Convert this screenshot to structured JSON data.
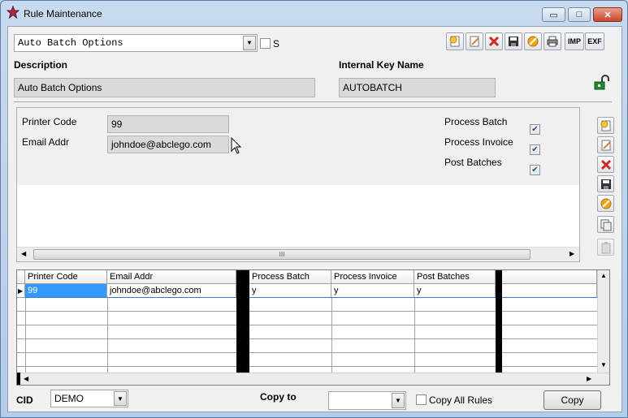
{
  "window": {
    "title": "Rule Maintenance",
    "controls": {
      "minimize": "▭",
      "maximize": "□",
      "close": "✕"
    }
  },
  "header": {
    "rule_select": "Auto Batch Options",
    "s_checkbox_label": "S",
    "s_checked": false
  },
  "toolbar": {
    "buttons": [
      "new",
      "edit",
      "delete",
      "save",
      "cancel",
      "print"
    ],
    "imp_label": "IMP",
    "exp_label": "EXF"
  },
  "description": {
    "label": "Description",
    "value": "Auto Batch Options"
  },
  "internal_key": {
    "label": "Internal Key Name",
    "value": "AUTOBATCH"
  },
  "form": {
    "printer_code": {
      "label": "Printer Code",
      "value": "99"
    },
    "email_addr": {
      "label": "Email Addr",
      "value": "johndoe@abclego.com"
    },
    "process_batch": {
      "label": "Process Batch",
      "checked": true
    },
    "process_invoice": {
      "label": "Process Invoice",
      "checked": true
    },
    "post_batches": {
      "label": "Post Batches",
      "checked": true
    },
    "scroll_thumb": "III"
  },
  "grid": {
    "columns": [
      "Printer Code",
      "Email Addr",
      "Process Batch",
      "Process Invoice",
      "Post Batches"
    ],
    "rows": [
      [
        "99",
        "johndoe@abclego.com",
        "y",
        "y",
        "y"
      ]
    ]
  },
  "footer": {
    "cid_label": "CID",
    "cid_value": "DEMO",
    "copy_to_label": "Copy to",
    "copy_to_value": "",
    "copy_all_label": "Copy All Rules",
    "copy_all_checked": false,
    "copy_button": "Copy"
  },
  "colors": {
    "selected_cell": "#3399ff",
    "lock_green": "#1f8a2c",
    "delete_red": "#d22a1e"
  }
}
